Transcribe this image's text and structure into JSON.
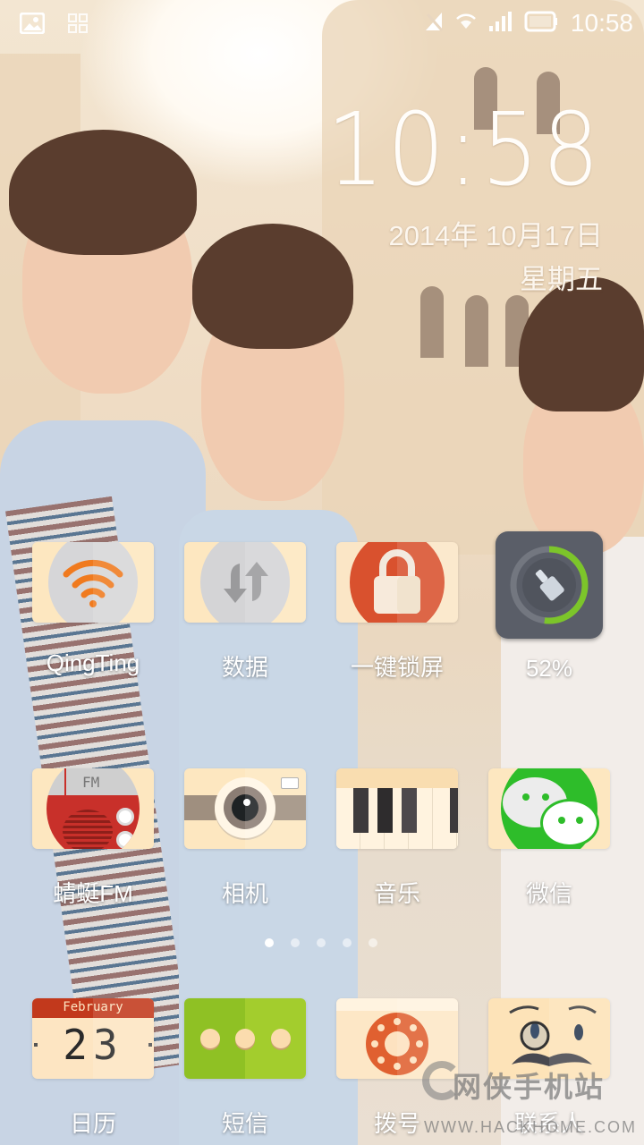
{
  "status_bar": {
    "left_icons": [
      "gallery-notification-icon",
      "qr-scan-icon"
    ],
    "right_icons": [
      "no-signal-icon",
      "wifi-icon",
      "cellular-signal-icon",
      "battery-icon"
    ],
    "time": "10:58"
  },
  "clock_widget": {
    "time": "10:58",
    "date": "2014年 10月17日",
    "weekday": "星期五"
  },
  "apps": [
    {
      "id": "qingting",
      "label": "QingTing",
      "icon": "wifi-icon"
    },
    {
      "id": "data",
      "label": "数据",
      "icon": "data-sync-icon"
    },
    {
      "id": "lockscreen",
      "label": "一键锁屏",
      "icon": "lock-icon"
    },
    {
      "id": "cleaner",
      "label": "52%",
      "icon": "broom-cleaner-icon",
      "progress_percent": 52
    },
    {
      "id": "qingting-fm",
      "label": "蜻蜓FM",
      "icon": "radio-icon",
      "icon_text": "FM"
    },
    {
      "id": "camera",
      "label": "相机",
      "icon": "camera-icon"
    },
    {
      "id": "music",
      "label": "音乐",
      "icon": "piano-icon"
    },
    {
      "id": "wechat",
      "label": "微信",
      "icon": "wechat-icon"
    }
  ],
  "page_indicator": {
    "count": 5,
    "active_index": 0
  },
  "dock": [
    {
      "id": "calendar",
      "label": "日历",
      "icon": "calendar-icon",
      "month": "February",
      "day": "23"
    },
    {
      "id": "sms",
      "label": "短信",
      "icon": "message-dots-icon"
    },
    {
      "id": "dialer",
      "label": "拨号",
      "icon": "rotary-dial-icon"
    },
    {
      "id": "contacts",
      "label": "联系人",
      "icon": "monocle-face-icon"
    }
  ],
  "watermark": {
    "name": "网侠手机站",
    "url": "WWW.HACKHOME.COM"
  },
  "colors": {
    "wifi_orange": "#f07a1e",
    "lock_red": "#d9512e",
    "cleaner_green": "#7cc52a",
    "cleaner_bg": "#5a5e68",
    "wechat_green": "#2ebd2a",
    "sms_green": "#9ccc2a",
    "calendar_red": "#c2391c",
    "icon_cream": "#fde7c0"
  }
}
